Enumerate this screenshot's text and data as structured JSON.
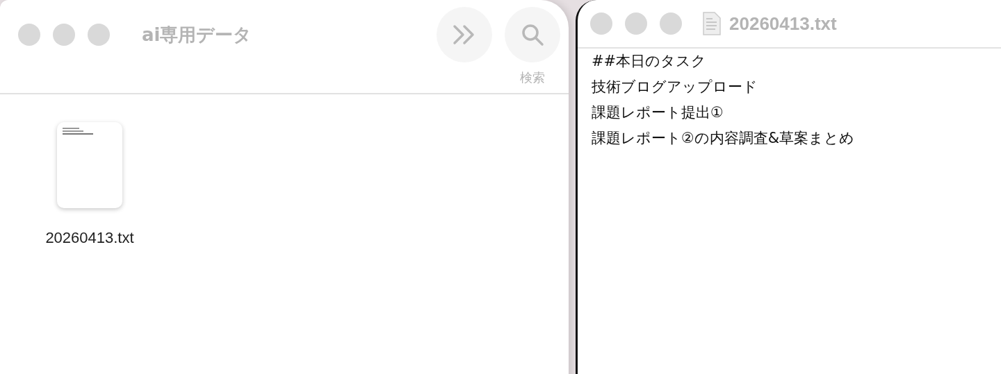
{
  "finder_window": {
    "title": "ai専用データ",
    "toolbar_buttons": [
      {
        "kind": "more"
      },
      {
        "kind": "search",
        "label": "検索"
      }
    ],
    "files": [
      {
        "name": "20260413.txt"
      }
    ]
  },
  "editor_window": {
    "title": "20260413.txt",
    "lines": [
      "##本日のタスク",
      "技術ブログアップロード",
      "課題レポート提出①",
      "課題レポート②の内容調査&草案まとめ"
    ]
  }
}
